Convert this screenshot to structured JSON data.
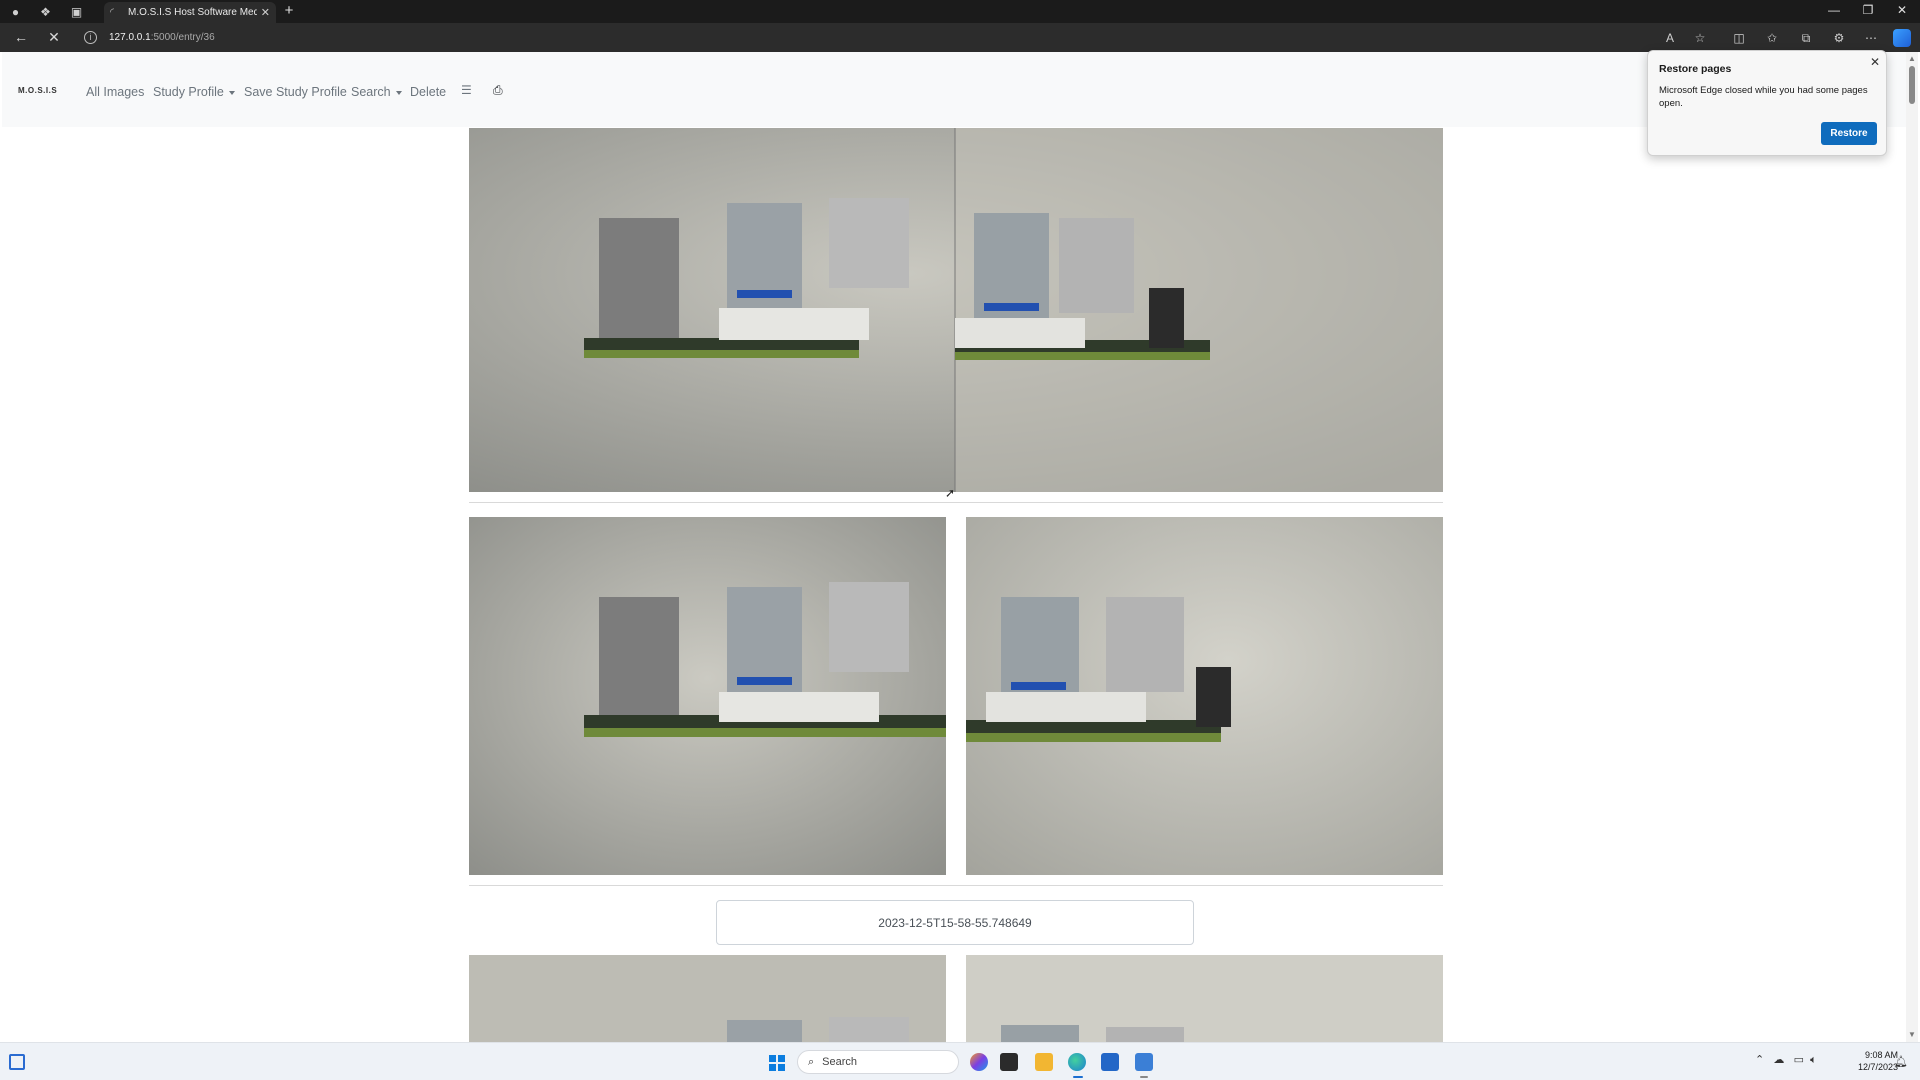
{
  "browser": {
    "tab_title": "M.O.S.I.S Host Software Media E",
    "url_host": "127.0.0.1",
    "url_path": ":5000/entry/36"
  },
  "site": {
    "logo": "M.O.S.I.S",
    "nav": {
      "all_images": "All Images",
      "study_profile": "Study Profile",
      "save_study_profile": "Save Study Profile",
      "search": "Search",
      "delete": "Delete"
    }
  },
  "entry": {
    "timestamp": "2023-12-5T15-58-55.748649"
  },
  "restore_popup": {
    "title": "Restore pages",
    "message": "Microsoft Edge closed while you had some pages open.",
    "button": "Restore"
  },
  "taskbar": {
    "search_placeholder": "Search",
    "time": "9:08 AM",
    "date": "12/7/2023"
  },
  "icons": {
    "browser_tools": [
      "read-aloud-icon",
      "favorite-star-icon",
      "split-screen-icon",
      "favorites-icon",
      "collections-icon",
      "extensions-icon",
      "more-icon",
      "copilot-icon"
    ],
    "nav_extra": [
      "list-icon",
      "printer-icon"
    ]
  },
  "colors": {
    "edge_dark": "#2c2c2c",
    "restore_accent": "#0f6cbd",
    "navbar_bg": "#f8f9fa"
  }
}
